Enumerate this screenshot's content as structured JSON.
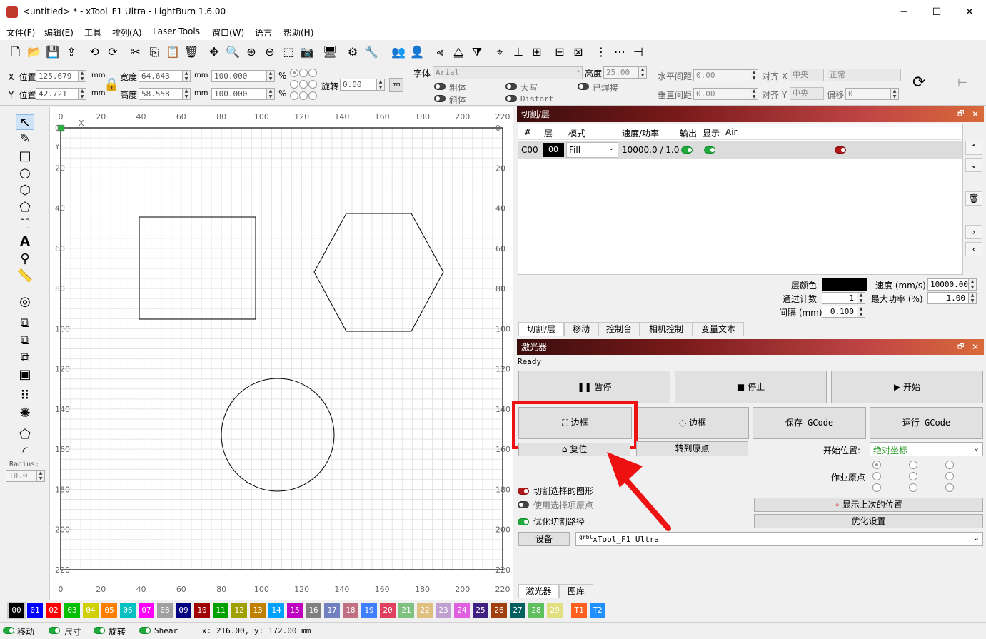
{
  "window": {
    "title": "<untitled> * - xTool_F1 Ultra - LightBurn 1.6.00",
    "minimize": "─",
    "maximize": "☐",
    "close": "✕"
  },
  "menu": [
    "文件(F)",
    "编辑(E)",
    "工具",
    "排列(A)",
    "Laser Tools",
    "窗口(W)",
    "语言",
    "帮助(H)"
  ],
  "props": {
    "x_label": "X 位置",
    "x_value": "125.679",
    "y_label": "Y 位置",
    "y_value": "42.721",
    "unit_mm": "mm",
    "width_label": "宽度",
    "width_value": "64.643",
    "height_label": "高度",
    "height_value": "58.558",
    "scale_w": "100.000",
    "scale_h": "100.000",
    "pct": "%",
    "rotate_label": "旋转",
    "rotate_value": "0.00",
    "mm_btn": "mm",
    "font_label": "字体",
    "font_value": "Arial",
    "fheight_label": "高度",
    "fheight_value": "25.00",
    "bold": "粗体",
    "italic": "斜体",
    "upper": "大写",
    "distort": "Distort",
    "welded": "已焊接",
    "hspace_label": "水平间距",
    "hspace_value": "0.00",
    "vspace_label": "垂直间距",
    "vspace_value": "0.00",
    "align_x": "对齐 X",
    "align_x_val": "中央",
    "align_y": "对齐 Y",
    "align_y_val": "中央",
    "normal": "正常",
    "offset_label": "偏移",
    "offset_value": "0"
  },
  "left_tools": {
    "radius_label": "Radius:",
    "radius_value": "10.0"
  },
  "ruler": {
    "top": [
      "0",
      "20",
      "40",
      "60",
      "80",
      "100",
      "120",
      "140",
      "160",
      "180",
      "200",
      "220"
    ],
    "left": [
      "0",
      "20",
      "40",
      "60",
      "80",
      "100",
      "120",
      "140",
      "160",
      "180",
      "200",
      "220"
    ],
    "x": "X",
    "y": "Y"
  },
  "cuts": {
    "title": "切割/层",
    "headers": [
      "#",
      "层",
      "模式",
      "速度/功率",
      "输出",
      "显示",
      "Air"
    ],
    "row": {
      "num": "C00",
      "layer": "00",
      "mode": "Fill",
      "speed": "10000.0 / 1.0"
    },
    "layer_color": "层颜色",
    "speed_label": "速度 (mm/s)",
    "speed_value": "10000.00",
    "passes_label": "通过计数",
    "passes_value": "1",
    "maxpow_label": "最大功率 (%)",
    "maxpow_value": "1.00",
    "interval_label": "间隔 (mm)",
    "interval_value": "0.100",
    "tabs": [
      "切割/层",
      "移动",
      "控制台",
      "相机控制",
      "变量文本"
    ]
  },
  "laser": {
    "title": "激光器",
    "status": "Ready",
    "pause": "暂停",
    "stop": "停止",
    "start": "开始",
    "frame1": "边框",
    "frame2": "边框",
    "save_gcode": "保存 GCode",
    "run_gcode": "运行 GCode",
    "home": "复位",
    "goto_origin": "转到原点",
    "start_from": "开始位置:",
    "start_from_val": "绝对坐标",
    "job_origin": "作业原点",
    "cut_selected": "切割选择的图形",
    "use_sel_origin": "使用选择项原点",
    "show_last": "显示上次的位置",
    "optimize": "优化切割路径",
    "opt_settings": "优化设置",
    "device_btn": "设备",
    "device": "xTool_F1 Ultra",
    "grbl": "grbl",
    "tabs": [
      "激光器",
      "图库"
    ]
  },
  "palette": [
    {
      "t": "00",
      "c": "#000000"
    },
    {
      "t": "01",
      "c": "#0000ff"
    },
    {
      "t": "02",
      "c": "#ff0000"
    },
    {
      "t": "03",
      "c": "#00c000"
    },
    {
      "t": "04",
      "c": "#d0d000"
    },
    {
      "t": "05",
      "c": "#ff8000"
    },
    {
      "t": "06",
      "c": "#00c0c0"
    },
    {
      "t": "07",
      "c": "#ff00ff"
    },
    {
      "t": "08",
      "c": "#a0a0a0"
    },
    {
      "t": "09",
      "c": "#000080"
    },
    {
      "t": "10",
      "c": "#a00000"
    },
    {
      "t": "11",
      "c": "#00a000"
    },
    {
      "t": "12",
      "c": "#a0a000"
    },
    {
      "t": "13",
      "c": "#c08000"
    },
    {
      "t": "14",
      "c": "#00a0ff"
    },
    {
      "t": "15",
      "c": "#c000c0"
    },
    {
      "t": "16",
      "c": "#808080"
    },
    {
      "t": "17",
      "c": "#7080c0"
    },
    {
      "t": "18",
      "c": "#c07080"
    },
    {
      "t": "19",
      "c": "#4080ff"
    },
    {
      "t": "20",
      "c": "#e04060"
    },
    {
      "t": "21",
      "c": "#80c080"
    },
    {
      "t": "22",
      "c": "#e0c080"
    },
    {
      "t": "23",
      "c": "#c0a0d0"
    },
    {
      "t": "24",
      "c": "#e060e0"
    },
    {
      "t": "25",
      "c": "#402080"
    },
    {
      "t": "26",
      "c": "#a04010"
    },
    {
      "t": "27",
      "c": "#006060"
    },
    {
      "t": "28",
      "c": "#60c060"
    },
    {
      "t": "29",
      "c": "#e0e080"
    },
    {
      "t": "T1",
      "c": "#ff6020"
    },
    {
      "t": "T2",
      "c": "#2090ff"
    }
  ],
  "status": {
    "move": "移动",
    "size": "尺寸",
    "rotate": "旋转",
    "shear": "Shear",
    "coords": "x: 216.00, y: 172.00 mm"
  }
}
